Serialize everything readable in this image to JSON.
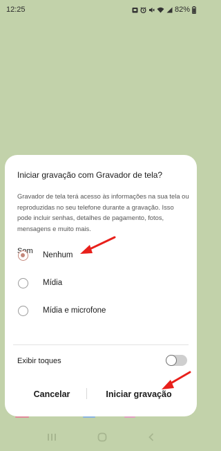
{
  "status_bar": {
    "time": "12:25",
    "battery": "82%",
    "icons": [
      "notification-icon",
      "alarm-icon",
      "mute-icon",
      "wifi-icon",
      "signal-icon",
      "battery-icon"
    ]
  },
  "dialog": {
    "title": "Iniciar gravação com Gravador de tela?",
    "description": "Gravador de tela terá acesso às informações na sua tela ou reproduzidas no seu telefone durante a gravação. Isso pode incluir senhas, detalhes de pagamento, fotos, mensagens e muito mais.",
    "sound_section": "Som",
    "options": [
      {
        "label": "Nenhum",
        "selected": true
      },
      {
        "label": "Mídia",
        "selected": false
      },
      {
        "label": "Mídia e microfone",
        "selected": false
      }
    ],
    "show_touches_label": "Exibir toques",
    "show_touches_on": false,
    "cancel_label": "Cancelar",
    "start_label": "Iniciar gravação"
  },
  "nav_bar": {
    "icons": [
      "recents-icon",
      "home-icon",
      "back-icon"
    ]
  },
  "colors": {
    "background": "#c2d2aa",
    "dialog": "#ffffff",
    "radio_selected": "#c4877a",
    "annotation_arrow": "#e8201b"
  }
}
